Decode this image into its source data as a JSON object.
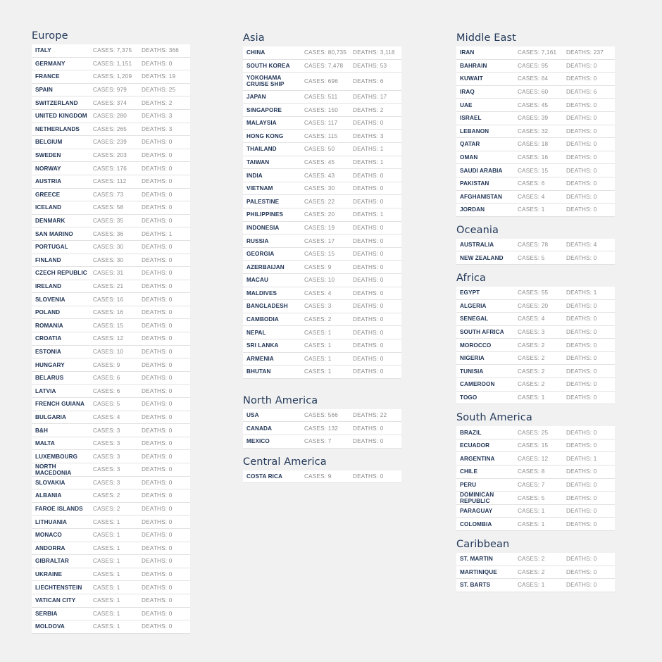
{
  "columns": [
    {
      "regions": [
        {
          "title": "Europe",
          "rows": [
            {
              "country": "ITALY",
              "cases": "CASES: 7,375",
              "deaths": "DEATHS: 366"
            },
            {
              "country": "GERMANY",
              "cases": "CASES: 1,151",
              "deaths": "DEATHS: 0"
            },
            {
              "country": "FRANCE",
              "cases": "CASES: 1,209",
              "deaths": "DEATHS: 19"
            },
            {
              "country": "SPAIN",
              "cases": "CASES: 979",
              "deaths": "DEATHS: 25"
            },
            {
              "country": "SWITZERLAND",
              "cases": "CASES: 374",
              "deaths": "DEATHS: 2"
            },
            {
              "country": "UNITED KINGDOM",
              "cases": "CASES: 280",
              "deaths": "DEATHS: 3"
            },
            {
              "country": "NETHERLANDS",
              "cases": "CASES: 265",
              "deaths": "DEATHS: 3"
            },
            {
              "country": "BELGIUM",
              "cases": "CASES: 239",
              "deaths": "DEATHS: 0"
            },
            {
              "country": "SWEDEN",
              "cases": "CASES: 203",
              "deaths": "DEATHS: 0"
            },
            {
              "country": "NORWAY",
              "cases": "CASES: 176",
              "deaths": "DEATHS: 0"
            },
            {
              "country": "AUSTRIA",
              "cases": "CASES: 112",
              "deaths": "DEATHS: 0"
            },
            {
              "country": "GREECE",
              "cases": "CASES: 73",
              "deaths": "DEATHS: 0"
            },
            {
              "country": "ICELAND",
              "cases": "CASES: 58",
              "deaths": "DEATHS: 0"
            },
            {
              "country": "DENMARK",
              "cases": "CASES: 35",
              "deaths": "DEATHS: 0"
            },
            {
              "country": "SAN MARINO",
              "cases": "CASES: 36",
              "deaths": "DEATHS: 1"
            },
            {
              "country": "PORTUGAL",
              "cases": "CASES: 30",
              "deaths": "DEATHS: 0"
            },
            {
              "country": "FINLAND",
              "cases": "CASES: 30",
              "deaths": "DEATHS: 0"
            },
            {
              "country": "CZECH REPUBLIC",
              "cases": "CASES: 31",
              "deaths": "DEATHS: 0"
            },
            {
              "country": "IRELAND",
              "cases": "CASES: 21",
              "deaths": "DEATHS: 0"
            },
            {
              "country": "SLOVENIA",
              "cases": "CASES: 16",
              "deaths": "DEATHS: 0"
            },
            {
              "country": "POLAND",
              "cases": "CASES: 16",
              "deaths": "DEATHS: 0"
            },
            {
              "country": "ROMANIA",
              "cases": "CASES: 15",
              "deaths": "DEATHS: 0"
            },
            {
              "country": "CROATIA",
              "cases": "CASES: 12",
              "deaths": "DEATHS: 0"
            },
            {
              "country": "ESTONIA",
              "cases": "CASES: 10",
              "deaths": "DEATHS: 0"
            },
            {
              "country": "HUNGARY",
              "cases": "CASES: 9",
              "deaths": "DEATHS: 0"
            },
            {
              "country": "BELARUS",
              "cases": "CASES: 6",
              "deaths": "DEATHS: 0"
            },
            {
              "country": "LATVIA",
              "cases": "CASES: 6",
              "deaths": "DEATHS: 0"
            },
            {
              "country": "FRENCH GUIANA",
              "cases": "CASES: 5",
              "deaths": "DEATHS: 0"
            },
            {
              "country": "BULGARIA",
              "cases": "CASES: 4",
              "deaths": "DEATHS: 0"
            },
            {
              "country": "B&H",
              "cases": "CASES: 3",
              "deaths": "DEATHS: 0"
            },
            {
              "country": "MALTA",
              "cases": "CASES: 3",
              "deaths": "DEATHS: 0"
            },
            {
              "country": "LUXEMBOURG",
              "cases": "CASES: 3",
              "deaths": "DEATHS: 0"
            },
            {
              "country": "NORTH MACEDONIA",
              "cases": "CASES: 3",
              "deaths": "DEATHS: 0"
            },
            {
              "country": "SLOVAKIA",
              "cases": "CASES: 3",
              "deaths": "DEATHS: 0"
            },
            {
              "country": "ALBANIA",
              "cases": "CASES: 2",
              "deaths": "DEATHS: 0"
            },
            {
              "country": "FAROE ISLANDS",
              "cases": "CASES: 2",
              "deaths": "DEATHS: 0"
            },
            {
              "country": "LITHUANIA",
              "cases": "CASES: 1",
              "deaths": "DEATHS: 0"
            },
            {
              "country": "MONACO",
              "cases": "CASES: 1",
              "deaths": "DEATHS: 0"
            },
            {
              "country": "ANDORRA",
              "cases": "CASES: 1",
              "deaths": "DEATHS: 0"
            },
            {
              "country": "GIBRALTAR",
              "cases": "CASES: 1",
              "deaths": "DEATHS: 0"
            },
            {
              "country": "UKRAINE",
              "cases": "CASES: 1",
              "deaths": "DEATHS: 0"
            },
            {
              "country": "LIECHTENSTEIN",
              "cases": "CASES: 1",
              "deaths": "DEATHS: 0"
            },
            {
              "country": "VATICAN CITY",
              "cases": "CASES: 1",
              "deaths": "DEATHS: 0"
            },
            {
              "country": "SERBIA",
              "cases": "CASES: 1",
              "deaths": "DEATHS: 0"
            },
            {
              "country": "MOLDOVA",
              "cases": "CASES: 1",
              "deaths": "DEATHS: 0"
            }
          ]
        }
      ]
    },
    {
      "regions": [
        {
          "title": "Asia",
          "rows": [
            {
              "country": "CHINA",
              "cases": "CASES: 80,735",
              "deaths": "DEATHS: 3,118"
            },
            {
              "country": "SOUTH KOREA",
              "cases": "CASES: 7,478",
              "deaths": "DEATHS: 53"
            },
            {
              "country": "YOKOHAMA CRUISE SHIP",
              "cases": "CASES: 696",
              "deaths": "DEATHS: 6"
            },
            {
              "country": "JAPAN",
              "cases": "CASES: 511",
              "deaths": "DEATHS: 17"
            },
            {
              "country": "SINGAPORE",
              "cases": "CASES: 150",
              "deaths": "DEATHS: 2"
            },
            {
              "country": "MALAYSIA",
              "cases": "CASES: 117",
              "deaths": "DEATHS: 0"
            },
            {
              "country": "HONG KONG",
              "cases": "CASES: 115",
              "deaths": "DEATHS: 3"
            },
            {
              "country": "THAILAND",
              "cases": "CASES: 50",
              "deaths": "DEATHS: 1"
            },
            {
              "country": "TAIWAN",
              "cases": "CASES: 45",
              "deaths": "DEATHS: 1"
            },
            {
              "country": "INDIA",
              "cases": "CASES: 43",
              "deaths": "DEATHS: 0"
            },
            {
              "country": "VIETNAM",
              "cases": "CASES: 30",
              "deaths": "DEATHS: 0"
            },
            {
              "country": "PALESTINE",
              "cases": "CASES: 22",
              "deaths": "DEATHS: 0"
            },
            {
              "country": "PHILIPPINES",
              "cases": "CASES: 20",
              "deaths": "DEATHS: 1"
            },
            {
              "country": "INDONESIA",
              "cases": "CASES: 19",
              "deaths": "DEATHS: 0"
            },
            {
              "country": "RUSSIA",
              "cases": "CASES: 17",
              "deaths": "DEATHS: 0"
            },
            {
              "country": "GEORGIA",
              "cases": "CASES: 15",
              "deaths": "DEATHS: 0"
            },
            {
              "country": "AZERBAIJAN",
              "cases": "CASES: 9",
              "deaths": "DEATHS: 0"
            },
            {
              "country": "MACAU",
              "cases": "CASES: 10",
              "deaths": "DEATHS: 0"
            },
            {
              "country": "MALDIVES",
              "cases": "CASES: 4",
              "deaths": "DEATHS: 0"
            },
            {
              "country": "BANGLADESH",
              "cases": "CASES: 3",
              "deaths": "DEATHS: 0"
            },
            {
              "country": "CAMBODIA",
              "cases": "CASES: 2",
              "deaths": "DEATHS: 0"
            },
            {
              "country": "NEPAL",
              "cases": "CASES: 1",
              "deaths": "DEATHS: 0"
            },
            {
              "country": "SRI LANKA",
              "cases": "CASES: 1",
              "deaths": "DEATHS: 0"
            },
            {
              "country": "ARMENIA",
              "cases": "CASES: 1",
              "deaths": "DEATHS: 0"
            },
            {
              "country": "BHUTAN",
              "cases": "CASES: 1",
              "deaths": "DEATHS: 0"
            }
          ]
        },
        {
          "title": "North America",
          "rows": [
            {
              "country": "USA",
              "cases": "CASES: 566",
              "deaths": "DEATHS: 22"
            },
            {
              "country": "CANADA",
              "cases": "CASES: 132",
              "deaths": "DEATHS: 0"
            },
            {
              "country": "MEXICO",
              "cases": "CASES: 7",
              "deaths": "DEATHS: 0"
            }
          ]
        },
        {
          "title": "Central America",
          "rows": [
            {
              "country": "COSTA RICA",
              "cases": "CASES: 9",
              "deaths": "DEATHS: 0"
            }
          ]
        }
      ]
    },
    {
      "regions": [
        {
          "title": "Middle East",
          "rows": [
            {
              "country": "IRAN",
              "cases": "CASES: 7,161",
              "deaths": "DEATHS: 237"
            },
            {
              "country": "BAHRAIN",
              "cases": "CASES: 95",
              "deaths": "DEATHS: 0"
            },
            {
              "country": "KUWAIT",
              "cases": "CASES: 64",
              "deaths": "DEATHS: 0"
            },
            {
              "country": "IRAQ",
              "cases": "CASES: 60",
              "deaths": "DEATHS: 6"
            },
            {
              "country": "UAE",
              "cases": "CASES: 45",
              "deaths": "DEATHS: 0"
            },
            {
              "country": "ISRAEL",
              "cases": "CASES: 39",
              "deaths": "DEATHS: 0"
            },
            {
              "country": "LEBANON",
              "cases": "CASES: 32",
              "deaths": "DEATHS: 0"
            },
            {
              "country": "QATAR",
              "cases": "CASES: 18",
              "deaths": "DEATHS: 0"
            },
            {
              "country": "OMAN",
              "cases": "CASES: 16",
              "deaths": "DEATHS: 0"
            },
            {
              "country": "SAUDI ARABIA",
              "cases": "CASES: 15",
              "deaths": "DEATHS: 0"
            },
            {
              "country": "PAKISTAN",
              "cases": "CASES: 6",
              "deaths": "DEATHS: 0"
            },
            {
              "country": "AFGHANISTAN",
              "cases": "CASES: 4",
              "deaths": "DEATHS: 0"
            },
            {
              "country": "JORDAN",
              "cases": "CASES: 1",
              "deaths": "DEATHS: 0"
            }
          ]
        },
        {
          "title": "Oceania",
          "rows": [
            {
              "country": "AUSTRALIA",
              "cases": "CASES: 78",
              "deaths": "DEATHS: 4"
            },
            {
              "country": "NEW ZEALAND",
              "cases": "CASES: 5",
              "deaths": "DEATHS: 0"
            }
          ]
        },
        {
          "title": "Africa",
          "rows": [
            {
              "country": "EGYPT",
              "cases": "CASES: 55",
              "deaths": "DEATHS: 1"
            },
            {
              "country": "ALGERIA",
              "cases": "CASES: 20",
              "deaths": "DEATHS: 0"
            },
            {
              "country": "SENEGAL",
              "cases": "CASES: 4",
              "deaths": "DEATHS: 0"
            },
            {
              "country": "SOUTH AFRICA",
              "cases": "CASES: 3",
              "deaths": "DEATHS: 0"
            },
            {
              "country": "MOROCCO",
              "cases": "CASES: 2",
              "deaths": "DEATHS: 0"
            },
            {
              "country": "NIGERIA",
              "cases": "CASES: 2",
              "deaths": "DEATHS: 0"
            },
            {
              "country": "TUNISIA",
              "cases": "CASES: 2",
              "deaths": "DEATHS: 0"
            },
            {
              "country": "CAMEROON",
              "cases": "CASES: 2",
              "deaths": "DEATHS: 0"
            },
            {
              "country": "TOGO",
              "cases": "CASES: 1",
              "deaths": "DEATHS: 0"
            }
          ]
        },
        {
          "title": "South America",
          "rows": [
            {
              "country": "BRAZIL",
              "cases": "CASES: 25",
              "deaths": "DEATHS: 0"
            },
            {
              "country": "ECUADOR",
              "cases": "CASES: 15",
              "deaths": "DEATHS: 0"
            },
            {
              "country": "ARGENTINA",
              "cases": "CASES: 12",
              "deaths": "DEATHS: 1"
            },
            {
              "country": "CHILE",
              "cases": "CASES: 8",
              "deaths": "DEATHS: 0"
            },
            {
              "country": "PERU",
              "cases": "CASES: 7",
              "deaths": "DEATHS: 0"
            },
            {
              "country": "DOMINICAN REPUBLIC",
              "cases": "CASES: 5",
              "deaths": "DEATHS: 0"
            },
            {
              "country": "PARAGUAY",
              "cases": "CASES: 1",
              "deaths": "DEATHS: 0"
            },
            {
              "country": "COLOMBIA",
              "cases": "CASES: 1",
              "deaths": "DEATHS: 0"
            }
          ]
        },
        {
          "title": "Caribbean",
          "rows": [
            {
              "country": "ST. MARTIN",
              "cases": "CASES: 2",
              "deaths": "DEATHS: 0"
            },
            {
              "country": "MARTINIQUE",
              "cases": "CASES: 2",
              "deaths": "DEATHS: 0"
            },
            {
              "country": "ST. BARTS",
              "cases": "CASES: 1",
              "deaths": "DEATHS: 0"
            }
          ]
        }
      ]
    }
  ],
  "colors": {
    "background": "#f1f1f1",
    "title": "#243a5a",
    "country": "#1f3355",
    "value": "#8b8b8b",
    "row_border": "#e2e2e2"
  }
}
